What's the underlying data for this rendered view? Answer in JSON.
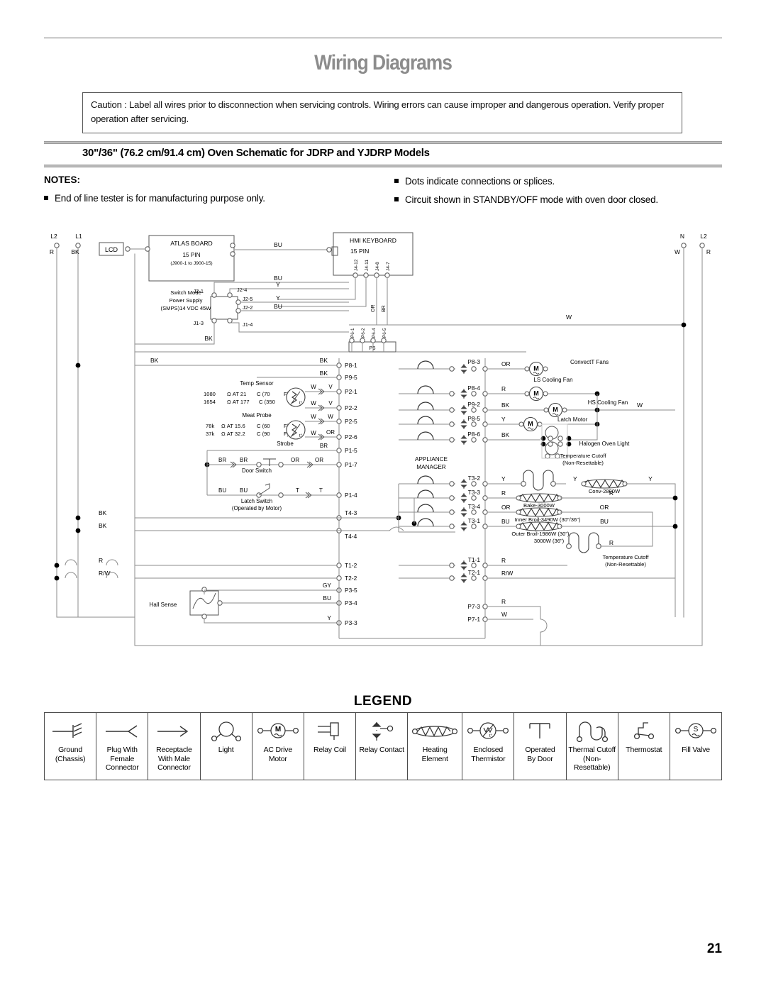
{
  "document": {
    "title": "Wiring Diagrams",
    "page_number": "21",
    "caution": "Caution : Label all wires prior to disconnection when servicing controls. Wiring errors can cause improper and dangerous operation. Verify proper operation after servicing.",
    "section_heading": "30\"/36\" (76.2 cm/91.4 cm) Oven Schematic for JDRP and YJDRP Models"
  },
  "notes": {
    "title": "NOTES:",
    "items": [
      "End of line tester is for manufacturing purpose only.",
      "Dots indicate connections or splices.",
      "Circuit shown in STANDBY/OFF mode with oven door closed."
    ]
  },
  "schematic": {
    "supply": {
      "l2_label": "L2",
      "l1_label": "L1",
      "l2_wire": "R",
      "l1_wire": "BK",
      "right_n_label": "N",
      "right_l2_label": "L2",
      "right_n_wire": "W",
      "right_l2_wire": "R"
    },
    "atlas_board": {
      "title": "ATLAS BOARD",
      "pin_count": "15 PIN",
      "pin_range": "(J900-1 to J900-15)",
      "lcd_label": "LCD",
      "out_wire": "BU"
    },
    "hmi_keyboard": {
      "title": "HMI KEYBOARD",
      "pin_count": "15 PIN",
      "pins": [
        "J4-12",
        "J4-11",
        "J4-8",
        "J4-7"
      ],
      "wire_or": "OR",
      "wire_br": "BR"
    },
    "smps": {
      "line1": "Switch Mode",
      "line2": "Power Supply",
      "line3": "(SMPS)14 VDC 45W",
      "pins_left": [
        "J2-1",
        "J1-3"
      ],
      "pins_right": [
        "J2-4",
        "J2-5",
        "J2-2",
        "J1-4"
      ],
      "wires": [
        "BU",
        "Y",
        "Y",
        "BU"
      ],
      "bk_label": "BK",
      "w_label": "W"
    },
    "p6_connector": {
      "label": "P6",
      "pins": [
        "P6-1",
        "P6-2",
        "P6-4",
        "P6-5"
      ]
    },
    "temp_sensor": {
      "title": "Temp Sensor",
      "row1": "1080  Ω AT 21   C (70    F)",
      "row2": "1654  Ω  AT 177   C (350   F)"
    },
    "meat_probe": {
      "title": "Meat Probe",
      "row1": "78k  Ω AT 15.6   C (60    F)",
      "row2": "37k  Ω AT 32.2   C (90    F)"
    },
    "switches": {
      "strobe": "Strobe",
      "door_switch": "Door Switch",
      "latch_switch_l1": "Latch Switch",
      "latch_switch_l2": "(Operated by Motor)",
      "hall_sense": "Hall Sense"
    },
    "appliance_manager": {
      "line1": "APPLIANCE",
      "line2": "MANAGER"
    },
    "motors": [
      {
        "name": "ConvectT Fans"
      },
      {
        "name": "LS Cooling Fan"
      },
      {
        "name": "HS Cooling Fan"
      },
      {
        "name": "Latch Motor"
      },
      {
        "name": "Halogen Oven Light"
      }
    ],
    "elements": [
      {
        "name": "Conv-2800W"
      },
      {
        "name": "Bake-3000W"
      },
      {
        "name": "Inner Broil-3490W (30\"/36\")"
      },
      {
        "name": "Outer Broil-1986W (30\")"
      },
      {
        "name": "3000W (36\")"
      }
    ],
    "cutoffs": [
      {
        "line1": "Temperature Cutoff",
        "line2": "(Non-Resettable)"
      },
      {
        "line1": "Temperature Cutoff",
        "line2": "(Non-Resettable)"
      }
    ],
    "terminals_left": [
      "P8-1",
      "P9-5",
      "P2-1",
      "P2-2",
      "P2-5",
      "P2-6",
      "P1-5",
      "P1-7",
      "P1-4",
      "T4-3",
      "T4-4",
      "T1-2",
      "T2-2"
    ],
    "terminals_mid": [
      "P8-3",
      "P8-4",
      "P9-2",
      "P8-5",
      "P8-6",
      "T3-2",
      "T3-3",
      "T3-4",
      "T3-1",
      "T1-1",
      "T2-1"
    ],
    "terminals_hall": [
      "P3-5",
      "P3-4",
      "P3-3"
    ],
    "terminals_p7": [
      "P7-3",
      "P7-1"
    ],
    "wire_codes": {
      "bk": "BK",
      "bu": "BU",
      "br": "BR",
      "or": "OR",
      "w": "W",
      "v": "V",
      "y": "Y",
      "r": "R",
      "rw": "R/W",
      "t": "T",
      "gy": "GY"
    }
  },
  "legend": {
    "title": "LEGEND",
    "items": [
      {
        "icon": "ground-chassis-icon",
        "label": "Ground\n(Chassis)"
      },
      {
        "icon": "plug-female-connector-icon",
        "label": "Plug With\nFemale\nConnector"
      },
      {
        "icon": "receptacle-male-connector-icon",
        "label": "Receptacle\nWith Male\nConnector"
      },
      {
        "icon": "light-icon",
        "label": "Light"
      },
      {
        "icon": "ac-drive-motor-icon",
        "label": "AC Drive\nMotor"
      },
      {
        "icon": "relay-coil-icon",
        "label": "Relay Coil"
      },
      {
        "icon": "relay-contact-icon",
        "label": "Relay Contact"
      },
      {
        "icon": "heating-element-icon",
        "label": "Heating\nElement"
      },
      {
        "icon": "enclosed-thermistor-icon",
        "label": "Enclosed\nThermistor"
      },
      {
        "icon": "operated-by-door-icon",
        "label": "Operated\nBy Door"
      },
      {
        "icon": "thermal-cutoff-icon",
        "label": "Thermal Cutoff\n(Non-\nResettable)"
      },
      {
        "icon": "thermostat-icon",
        "label": "Thermostat"
      },
      {
        "icon": "fill-valve-icon",
        "label": "Fill Valve"
      }
    ]
  }
}
